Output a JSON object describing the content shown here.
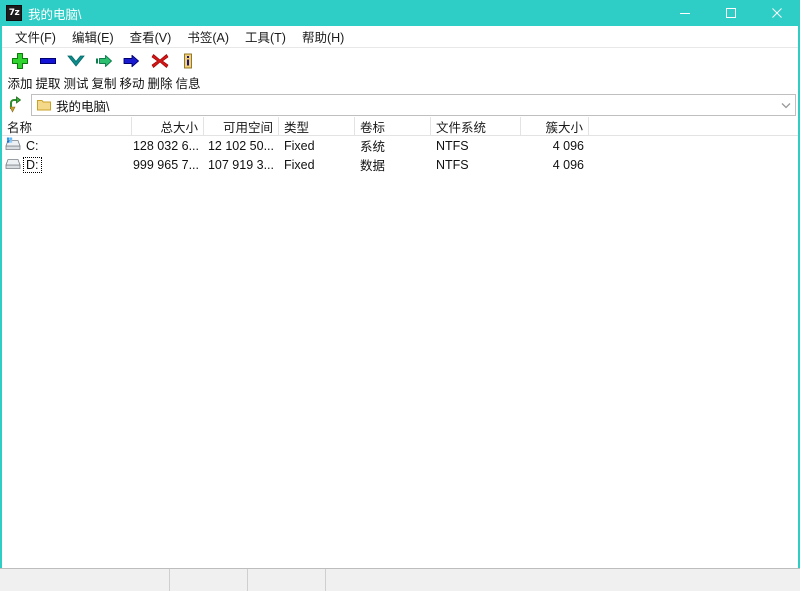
{
  "window": {
    "app_icon_text": "7z",
    "title": "我的电脑\\",
    "accent_color": "#2ecdc5",
    "controls": {
      "minimize": "minimize-button",
      "maximize": "maximize-button",
      "close": "close-button"
    }
  },
  "menu": {
    "items": [
      {
        "label": "文件(F)"
      },
      {
        "label": "编辑(E)"
      },
      {
        "label": "查看(V)"
      },
      {
        "label": "书签(A)"
      },
      {
        "label": "工具(T)"
      },
      {
        "label": "帮助(H)"
      }
    ]
  },
  "toolbar": {
    "buttons": [
      {
        "label": "添加",
        "icon": "plus-icon",
        "color": "#22b222"
      },
      {
        "label": "提取",
        "icon": "minus-icon",
        "color": "#0000c8"
      },
      {
        "label": "测试",
        "icon": "chevron-down-icon",
        "color": "#008080"
      },
      {
        "label": "复制",
        "icon": "arrow-right-copy-icon",
        "color": "#1faa6b"
      },
      {
        "label": "移动",
        "icon": "arrow-right-move-icon",
        "color": "#00008b"
      },
      {
        "label": "删除",
        "icon": "cross-icon",
        "color": "#cc0000"
      },
      {
        "label": "信息",
        "icon": "info-icon",
        "color": "#d4a017"
      }
    ]
  },
  "address_bar": {
    "up_button": "up-one-level-button",
    "folder_icon": "folder-icon",
    "path": "我的电脑\\",
    "dropdown_icon": "chevron-down-icon"
  },
  "file_list": {
    "columns": [
      {
        "label": "名称",
        "align": "left"
      },
      {
        "label": "总大小",
        "align": "right"
      },
      {
        "label": "可用空间",
        "align": "right"
      },
      {
        "label": "类型",
        "align": "left"
      },
      {
        "label": "卷标",
        "align": "left"
      },
      {
        "label": "文件系统",
        "align": "left"
      },
      {
        "label": "簇大小",
        "align": "right"
      }
    ],
    "rows": [
      {
        "name": "C:",
        "icon": "hard-drive-system-icon",
        "total_size": "128 032 6...",
        "free_space": "12 102 50...",
        "type": "Fixed",
        "volume_label": "系统",
        "file_system": "NTFS",
        "cluster_size": "4 096",
        "focused": false
      },
      {
        "name": "D:",
        "icon": "hard-drive-icon",
        "total_size": "999 965 7...",
        "free_space": "107 919 3...",
        "type": "Fixed",
        "volume_label": "数据",
        "file_system": "NTFS",
        "cluster_size": "4 096",
        "focused": true
      }
    ]
  },
  "status_bar": {
    "panes": [
      "",
      "",
      "",
      ""
    ]
  }
}
